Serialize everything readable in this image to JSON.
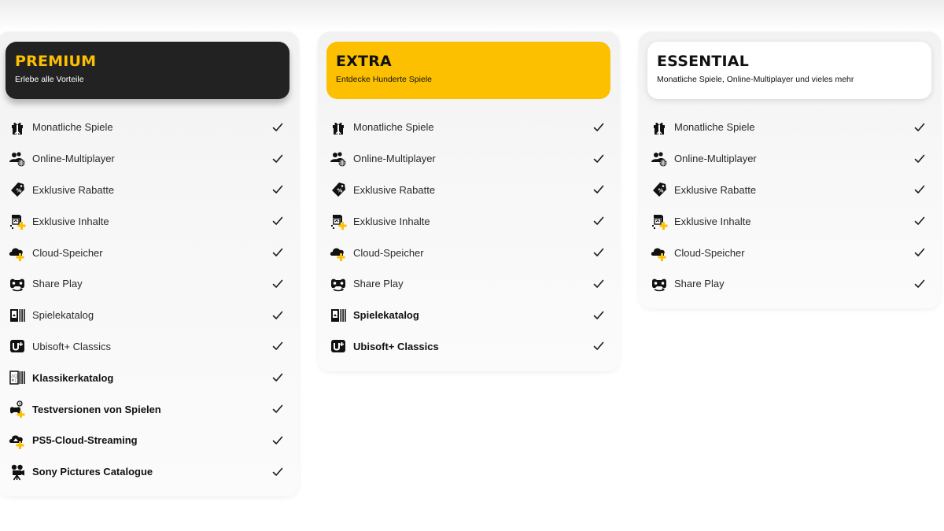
{
  "colors": {
    "accent_yellow": "#fcc000",
    "dark_header": "#222222",
    "white_header": "#ffffff",
    "text": "#1f1f1f"
  },
  "tiers": [
    {
      "id": "premium",
      "name": "PREMIUM",
      "subtitle": "Erlebe alle Vorteile",
      "features": [
        {
          "label": "Monatliche Spiele",
          "icon": "gift-icon",
          "included": true
        },
        {
          "label": "Online-Multiplayer",
          "icon": "multiplayer-icon",
          "included": true
        },
        {
          "label": "Exklusive Rabatte",
          "icon": "discount-tag-icon",
          "included": true
        },
        {
          "label": "Exklusive Inhalte",
          "icon": "exclusive-content-icon",
          "included": true
        },
        {
          "label": "Cloud-Speicher",
          "icon": "cloud-storage-icon",
          "included": true
        },
        {
          "label": "Share Play",
          "icon": "share-play-icon",
          "included": true
        },
        {
          "label": "Spielekatalog",
          "icon": "game-catalog-icon",
          "included": true
        },
        {
          "label": "Ubisoft+ Classics",
          "icon": "ubisoft-plus-icon",
          "included": true
        },
        {
          "label": "Klassikerkatalog",
          "icon": "classics-catalog-icon",
          "included": true
        },
        {
          "label": "Testversionen von Spielen",
          "icon": "game-trial-icon",
          "included": true
        },
        {
          "label": "PS5-Cloud-Streaming",
          "icon": "cloud-streaming-icon",
          "included": true
        },
        {
          "label": "Sony Pictures Catalogue",
          "icon": "film-camera-icon",
          "included": true
        }
      ]
    },
    {
      "id": "extra",
      "name": "EXTRA",
      "subtitle": "Entdecke Hunderte Spiele",
      "features": [
        {
          "label": "Monatliche Spiele",
          "icon": "gift-icon",
          "included": true
        },
        {
          "label": "Online-Multiplayer",
          "icon": "multiplayer-icon",
          "included": true
        },
        {
          "label": "Exklusive Rabatte",
          "icon": "discount-tag-icon",
          "included": true
        },
        {
          "label": "Exklusive Inhalte",
          "icon": "exclusive-content-icon",
          "included": true
        },
        {
          "label": "Cloud-Speicher",
          "icon": "cloud-storage-icon",
          "included": true
        },
        {
          "label": "Share Play",
          "icon": "share-play-icon",
          "included": true
        },
        {
          "label": "Spielekatalog",
          "icon": "game-catalog-icon",
          "included": true
        },
        {
          "label": "Ubisoft+ Classics",
          "icon": "ubisoft-plus-icon",
          "included": true
        }
      ]
    },
    {
      "id": "essential",
      "name": "ESSENTIAL",
      "subtitle": "Monatliche Spiele, Online-Multiplayer und vieles mehr",
      "features": [
        {
          "label": "Monatliche Spiele",
          "icon": "gift-icon",
          "included": true
        },
        {
          "label": "Online-Multiplayer",
          "icon": "multiplayer-icon",
          "included": true
        },
        {
          "label": "Exklusive Rabatte",
          "icon": "discount-tag-icon",
          "included": true
        },
        {
          "label": "Exklusive Inhalte",
          "icon": "exclusive-content-icon",
          "included": true
        },
        {
          "label": "Cloud-Speicher",
          "icon": "cloud-storage-icon",
          "included": true
        },
        {
          "label": "Share Play",
          "icon": "share-play-icon",
          "included": true
        }
      ]
    }
  ]
}
